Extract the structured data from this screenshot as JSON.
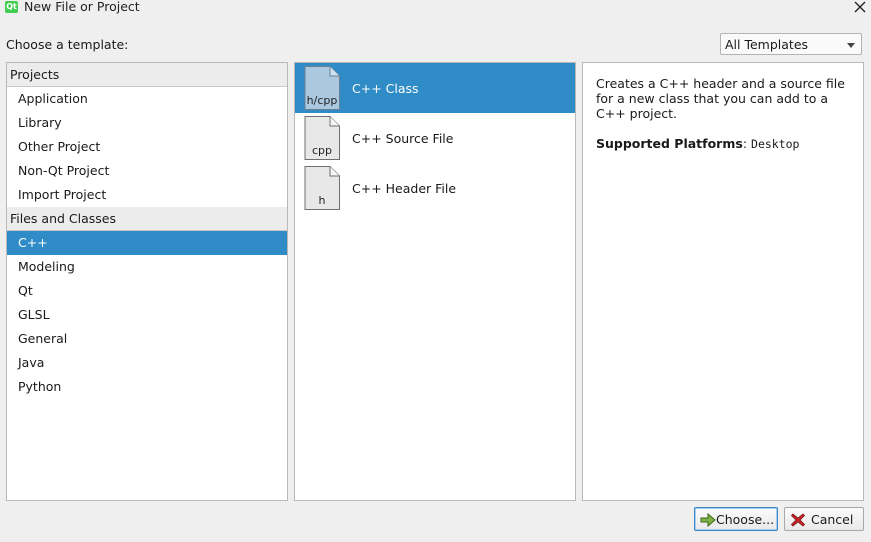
{
  "window": {
    "app_logo": "Qt",
    "title": "New File or Project",
    "close_icon": "close-icon"
  },
  "header": {
    "choose_label": "Choose a template:",
    "template_filter": "All Templates"
  },
  "categories": {
    "groups": [
      {
        "title": "Projects",
        "items": [
          "Application",
          "Library",
          "Other Project",
          "Non-Qt Project",
          "Import Project"
        ]
      },
      {
        "title": "Files and Classes",
        "items": [
          "C++",
          "Modeling",
          "Qt",
          "GLSL",
          "General",
          "Java",
          "Python"
        ]
      }
    ],
    "selected": "C++"
  },
  "templates": [
    {
      "icon_text": "h/cpp",
      "label": "C++ Class",
      "selected": true
    },
    {
      "icon_text": "cpp",
      "label": "C++ Source File",
      "selected": false
    },
    {
      "icon_text": "h",
      "label": "C++ Header File",
      "selected": false
    }
  ],
  "description": {
    "text": "Creates a C++ header and a source file for a new class that you can add to a C++ project.",
    "platforms_label": "Supported Platforms",
    "platforms_value": "Desktop"
  },
  "buttons": {
    "choose": "Choose...",
    "cancel": "Cancel"
  },
  "colors": {
    "selection": "#308cc6",
    "qt_green": "#41cd52"
  }
}
